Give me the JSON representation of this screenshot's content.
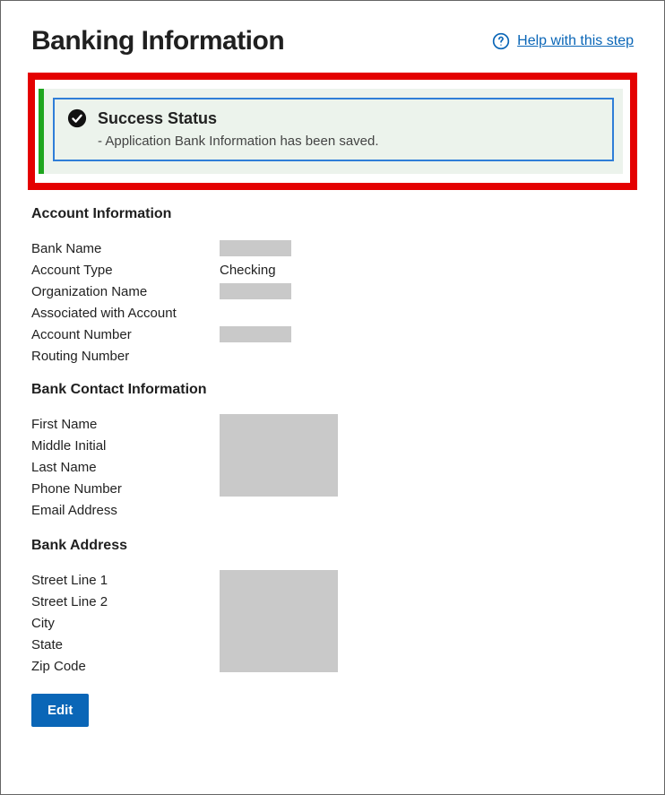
{
  "header": {
    "title": "Banking Information",
    "help_label": " Help with this step"
  },
  "status": {
    "title": "Success Status",
    "message": "Application Bank Information has been saved."
  },
  "sections": {
    "account": {
      "heading": "Account Information",
      "fields": {
        "bank_name": {
          "label": "Bank Name",
          "value": ""
        },
        "account_type": {
          "label": "Account Type",
          "value": "Checking"
        },
        "org_name": {
          "label": "Organization Name",
          "value": ""
        },
        "assoc_account": {
          "label": "Associated with Account",
          "value": ""
        },
        "account_number": {
          "label": "Account Number",
          "value": ""
        },
        "routing_number": {
          "label": "Routing Number",
          "value": ""
        }
      }
    },
    "contact": {
      "heading": "Bank Contact Information",
      "fields": {
        "first_name": {
          "label": "First Name"
        },
        "middle_initial": {
          "label": "Middle Initial"
        },
        "last_name": {
          "label": "Last Name"
        },
        "phone": {
          "label": "Phone Number"
        },
        "email": {
          "label": "Email Address"
        }
      }
    },
    "address": {
      "heading": "Bank Address",
      "fields": {
        "street1": {
          "label": "Street Line 1"
        },
        "street2": {
          "label": "Street Line 2"
        },
        "city": {
          "label": "City"
        },
        "state": {
          "label": "State"
        },
        "zip": {
          "label": "Zip Code"
        }
      }
    }
  },
  "buttons": {
    "edit": "Edit"
  },
  "colors": {
    "highlight_border": "#e40000",
    "status_bg": "#ecf3ec",
    "status_border_left": "#1fa61f",
    "status_inner_border": "#2f7ed8",
    "link": "#0a66b7",
    "button_bg": "#0a66b7",
    "redact": "#c9c9c9"
  }
}
